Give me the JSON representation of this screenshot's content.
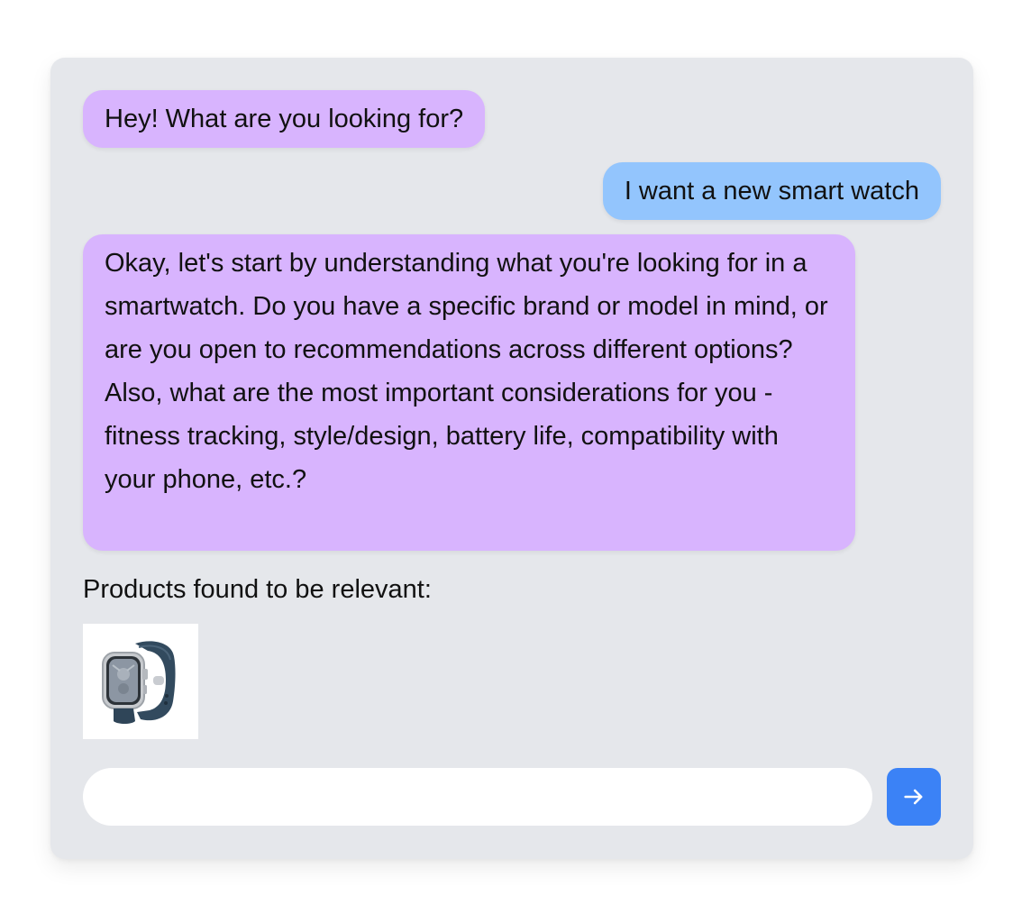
{
  "chat": {
    "messages": [
      {
        "role": "assistant",
        "text": "Hey! What are you looking for?"
      },
      {
        "role": "user",
        "text": "I want a new smart watch"
      },
      {
        "role": "assistant",
        "text": "Okay, let's start by understanding what you're looking for in a smartwatch. Do you have a specific brand or model in mind, or are you open to recommendations across different options? Also, what are the most important considerations for you - fitness tracking, style/design, battery life, compatibility with your phone, etc.?"
      }
    ],
    "products_label": "Products found to be relevant:",
    "products": [
      {
        "icon": "smartwatch-product-image"
      }
    ]
  },
  "input": {
    "value": "",
    "placeholder": ""
  },
  "send_button": {
    "icon": "arrow-right-icon"
  },
  "colors": {
    "panel_background": "#e5e7eb",
    "assistant_bubble": "#d8b4fe",
    "user_bubble": "#93c5fd",
    "send_button": "#3b82f6"
  }
}
